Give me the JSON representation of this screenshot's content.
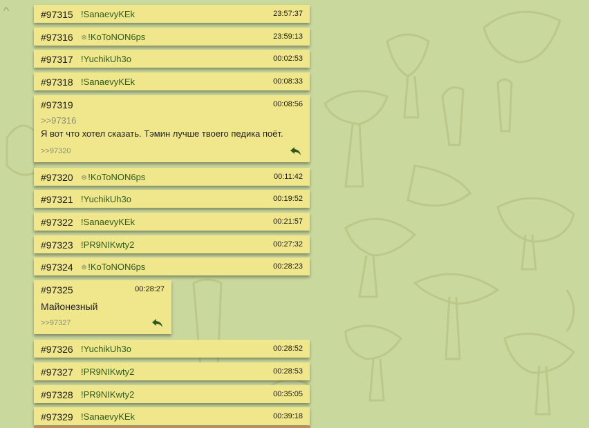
{
  "posts": [
    {
      "num": "#97315",
      "trip": "!SanaevyKEk",
      "flake": false,
      "time": "23:57:37"
    },
    {
      "num": "#97316",
      "trip": "!KoToNON6ps",
      "flake": true,
      "time": "23:59:13"
    },
    {
      "num": "#97317",
      "trip": "!YuchikUh3o",
      "flake": false,
      "time": "00:02:53"
    },
    {
      "num": "#97318",
      "trip": "!SanaevyKEk",
      "flake": false,
      "time": "00:08:33"
    },
    {
      "num": "#97319",
      "trip": "",
      "flake": false,
      "time": "00:08:56",
      "quote": ">>97316",
      "text": "Я вот что хотел сказать. Тэмин лучше твоего педика поёт.",
      "reply": ">>97320"
    },
    {
      "num": "#97320",
      "trip": "!KoToNON6ps",
      "flake": true,
      "time": "00:11:42"
    },
    {
      "num": "#97321",
      "trip": "!YuchikUh3o",
      "flake": false,
      "time": "00:19:52"
    },
    {
      "num": "#97322",
      "trip": "!SanaevyKEk",
      "flake": false,
      "time": "00:21:57"
    },
    {
      "num": "#97323",
      "trip": "!PR9NIKwty2",
      "flake": false,
      "time": "00:27:32"
    },
    {
      "num": "#97324",
      "trip": "!KoToNON6ps",
      "flake": true,
      "time": "00:28:23"
    },
    {
      "num": "#97325",
      "trip": "",
      "flake": false,
      "time": "00:28:27",
      "text": "Майонезный",
      "reply": ">>97327"
    },
    {
      "num": "#97326",
      "trip": "!YuchikUh3o",
      "flake": false,
      "time": "00:28:52"
    },
    {
      "num": "#97327",
      "trip": "!PR9NIKwty2",
      "flake": false,
      "time": "00:28:53"
    },
    {
      "num": "#97328",
      "trip": "!PR9NIKwty2",
      "flake": false,
      "time": "00:35:05"
    },
    {
      "num": "#97329",
      "trip": "!SanaevyKEk",
      "flake": false,
      "time": "00:39:18"
    }
  ],
  "icons": {
    "flake": "snowflake-icon",
    "reply": "reply-arrow-icon",
    "scroll": "chevron-up-icon"
  },
  "colors": {
    "background": "#c9d89d",
    "post": "#f0e68c",
    "trip": "#2f5a1f",
    "muted": "#8a8f78",
    "reply_icon": "#2f5a1f"
  }
}
